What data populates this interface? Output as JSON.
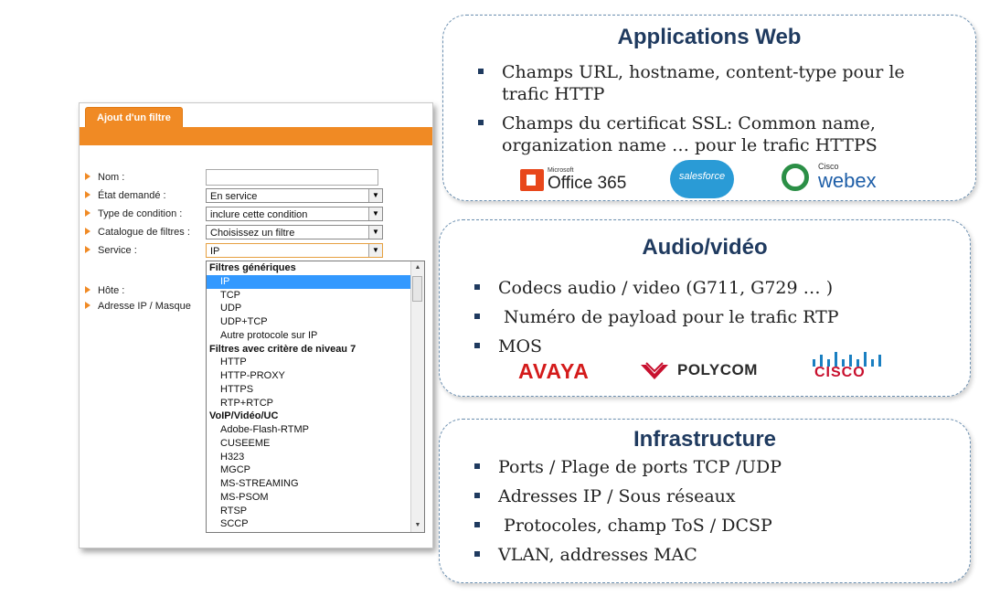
{
  "form": {
    "tab_label": "Ajout d'un filtre",
    "fields": [
      {
        "label": "Nom :",
        "value": ""
      },
      {
        "label": "État demandé :",
        "value": "En service"
      },
      {
        "label": "Type de condition :",
        "value": "inclure cette condition"
      },
      {
        "label": "Catalogue de filtres :",
        "value": "Choisissez un filtre"
      },
      {
        "label": "Service :",
        "value": "IP"
      },
      {
        "label": "Hôte :"
      },
      {
        "label": "Adresse IP / Masque"
      }
    ],
    "dropdown": [
      {
        "text": "Filtres génériques",
        "group": true
      },
      {
        "text": "IP",
        "selected": true
      },
      {
        "text": "TCP"
      },
      {
        "text": "UDP"
      },
      {
        "text": "UDP+TCP"
      },
      {
        "text": "Autre protocole sur IP"
      },
      {
        "text": "Filtres avec critère de niveau 7",
        "group": true
      },
      {
        "text": "HTTP"
      },
      {
        "text": "HTTP-PROXY"
      },
      {
        "text": "HTTPS"
      },
      {
        "text": "RTP+RTCP"
      },
      {
        "text": "VoIP/Vidéo/UC",
        "group": true
      },
      {
        "text": "Adobe-Flash-RTMP"
      },
      {
        "text": "CUSEEME"
      },
      {
        "text": "H323"
      },
      {
        "text": "MGCP"
      },
      {
        "text": "MS-STREAMING"
      },
      {
        "text": "MS-PSOM"
      },
      {
        "text": "RTSP"
      },
      {
        "text": "SCCP"
      }
    ]
  },
  "panels": {
    "web": {
      "title": "Applications Web",
      "bullets": [
        [
          "Champs URL, hostname, content-type  pour le",
          "trafic HTTP"
        ],
        [
          "Champs du certificat SSL:  Common name,",
          "organization name …  pour le trafic HTTPS"
        ]
      ],
      "logos": {
        "office_small": "Microsoft",
        "office": "Office 365",
        "salesforce": "salesforce",
        "webex_small": "Cisco",
        "webex": "webex"
      }
    },
    "av": {
      "title": "Audio/vidéo",
      "bullets": [
        "Codecs audio / video (G711, G729 … )",
        " Numéro de payload pour le trafic RTP",
        "MOS"
      ],
      "logos": {
        "avaya": "AVAYA",
        "polycom": "POLYCOM",
        "cisco": "CISCO"
      }
    },
    "infra": {
      "title": "Infrastructure",
      "bullets": [
        "Ports / Plage de ports TCP /UDP",
        "Adresses IP / Sous réseaux",
        " Protocoles, champ ToS / DCSP",
        "VLAN, addresses MAC"
      ]
    }
  },
  "colors": {
    "orange": "#f08a24",
    "selected": "#3399ff",
    "title_blue": "#1f3a5f",
    "panel_border": "#6b8fb0"
  }
}
